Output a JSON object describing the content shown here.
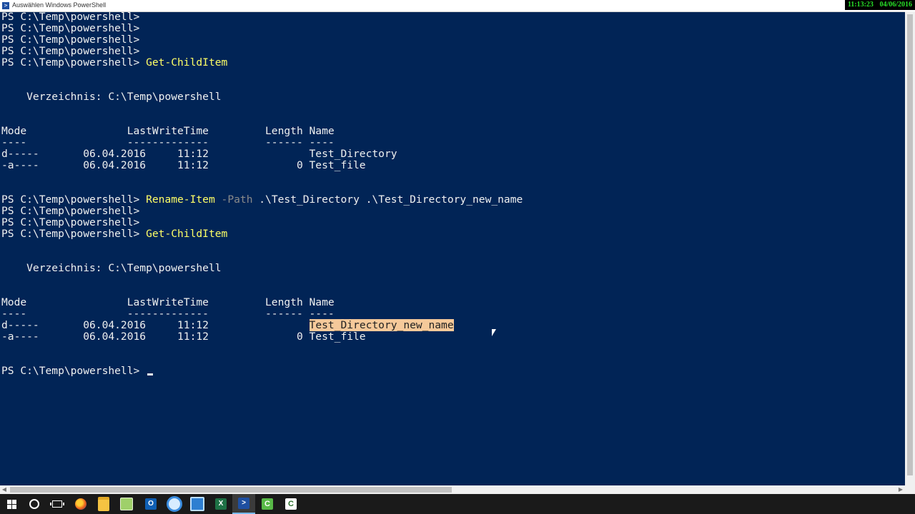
{
  "window": {
    "title": "Auswählen Windows PowerShell"
  },
  "clock": {
    "time": "11:13:23",
    "date": "04/06/2016"
  },
  "console": {
    "lines": [
      [
        {
          "t": "PS C:\\Temp\\powershell>"
        }
      ],
      [
        {
          "t": "PS C:\\Temp\\powershell>"
        }
      ],
      [
        {
          "t": "PS C:\\Temp\\powershell>"
        }
      ],
      [
        {
          "t": "PS C:\\Temp\\powershell>"
        }
      ],
      [
        {
          "t": "PS C:\\Temp\\powershell> "
        },
        {
          "t": "Get-ChildItem",
          "c": "cmd"
        }
      ],
      [],
      [],
      [
        {
          "t": "    Verzeichnis: C:\\Temp\\powershell"
        }
      ],
      [],
      [],
      [
        {
          "t": "Mode                LastWriteTime         Length Name"
        }
      ],
      [
        {
          "t": "----                -------------         ------ ----"
        }
      ],
      [
        {
          "t": "d-----       06.04.2016     11:12                Test_Directory"
        }
      ],
      [
        {
          "t": "-a----       06.04.2016     11:12              0 Test_file"
        }
      ],
      [],
      [],
      [
        {
          "t": "PS C:\\Temp\\powershell> "
        },
        {
          "t": "Rename-Item",
          "c": "cmd"
        },
        {
          "t": " "
        },
        {
          "t": "-Path",
          "c": "param"
        },
        {
          "t": " .\\Test_Directory .\\Test_Directory_new_name"
        }
      ],
      [
        {
          "t": "PS C:\\Temp\\powershell>"
        }
      ],
      [
        {
          "t": "PS C:\\Temp\\powershell>"
        }
      ],
      [
        {
          "t": "PS C:\\Temp\\powershell> "
        },
        {
          "t": "Get-ChildItem",
          "c": "cmd"
        }
      ],
      [],
      [],
      [
        {
          "t": "    Verzeichnis: C:\\Temp\\powershell"
        }
      ],
      [],
      [],
      [
        {
          "t": "Mode                LastWriteTime         Length Name"
        }
      ],
      [
        {
          "t": "----                -------------         ------ ----"
        }
      ],
      [
        {
          "t": "d-----       06.04.2016     11:12                "
        },
        {
          "t": "Test_Directory_new_name",
          "c": "hl"
        }
      ],
      [
        {
          "t": "-a----       06.04.2016     11:12              0 Test_file"
        }
      ],
      [],
      [],
      [
        {
          "t": "PS C:\\Temp\\powershell> "
        },
        {
          "cursor": true
        }
      ]
    ]
  },
  "taskbar": {
    "items": [
      {
        "name": "start-button",
        "icon": "windows-logo-icon"
      },
      {
        "name": "search-button",
        "icon": "search-icon"
      },
      {
        "name": "task-view-button",
        "icon": "task-view-icon"
      },
      {
        "name": "taskbar-firefox",
        "icon": "firefox-icon"
      },
      {
        "name": "taskbar-file-explorer",
        "icon": "folder-icon"
      },
      {
        "name": "taskbar-notepadpp",
        "icon": "notepad-icon"
      },
      {
        "name": "taskbar-outlook",
        "icon": "outlook-icon",
        "glyph": "O"
      },
      {
        "name": "taskbar-snipping-tool",
        "icon": "snipping-icon"
      },
      {
        "name": "taskbar-remote-desktop",
        "icon": "remote-desktop-icon"
      },
      {
        "name": "taskbar-excel",
        "icon": "excel-icon",
        "glyph": "X"
      },
      {
        "name": "taskbar-powershell",
        "icon": "powershell-icon",
        "glyph": ">",
        "active": true
      },
      {
        "name": "taskbar-camtasia-recorder",
        "icon": "camtasia-recorder-icon",
        "glyph": "C"
      },
      {
        "name": "taskbar-camtasia-studio",
        "icon": "camtasia-studio-icon",
        "glyph": "C"
      }
    ]
  }
}
